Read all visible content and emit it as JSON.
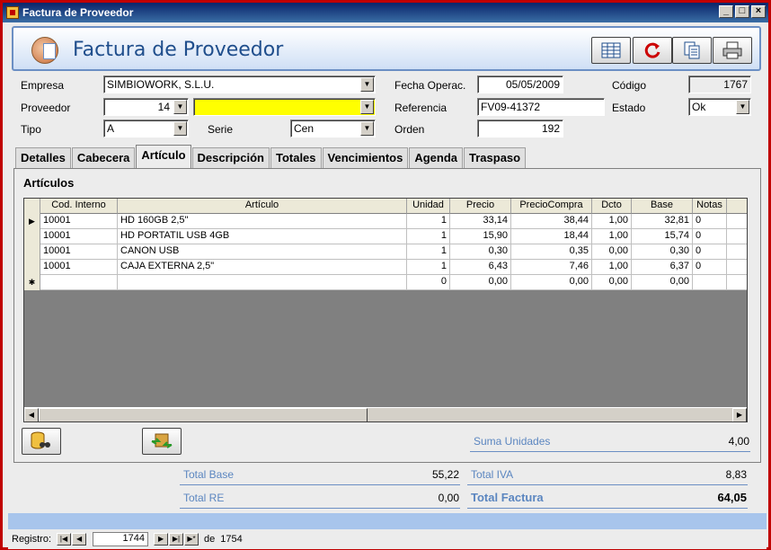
{
  "window": {
    "title": "Factura de Proveedor"
  },
  "header": {
    "title": "Factura de Proveedor"
  },
  "form": {
    "empresa_label": "Empresa",
    "empresa_value": "SIMBIOWORK, S.L.U.",
    "proveedor_label": "Proveedor",
    "proveedor_code": "14",
    "proveedor_name": "",
    "tipo_label": "Tipo",
    "tipo_value": "A",
    "serie_label": "Serie",
    "serie_value": "Cen",
    "fecha_label": "Fecha Operac.",
    "fecha_value": "05/05/2009",
    "referencia_label": "Referencia",
    "referencia_value": "FV09-41372",
    "orden_label": "Orden",
    "orden_value": "192",
    "codigo_label": "Código",
    "codigo_value": "1767",
    "estado_label": "Estado",
    "estado_value": "Ok"
  },
  "tabs": [
    "Detalles",
    "Cabecera",
    "Artículo",
    "Descripción",
    "Totales",
    "Vencimientos",
    "Agenda",
    "Traspaso"
  ],
  "active_tab": "Artículo",
  "panel": {
    "title": "Artículos"
  },
  "grid": {
    "columns": [
      "Cod. Interno",
      "Artículo",
      "Unidad",
      "Precio",
      "PrecioCompra",
      "Dcto",
      "Base",
      "Notas"
    ],
    "rows": [
      [
        "10001",
        "HD  160GB 2,5\"",
        "1",
        "33,14",
        "38,44",
        "1,00",
        "32,81",
        "0"
      ],
      [
        "10001",
        "HD PORTATIL USB 4GB",
        "1",
        "15,90",
        "18,44",
        "1,00",
        "15,74",
        "0"
      ],
      [
        "10001",
        "CANON USB",
        "1",
        "0,30",
        "0,35",
        "0,00",
        "0,30",
        "0"
      ],
      [
        "10001",
        "CAJA EXTERNA 2,5\"",
        "1",
        "6,43",
        "7,46",
        "1,00",
        "6,37",
        "0"
      ]
    ],
    "new_row": [
      "",
      "",
      "0",
      "0,00",
      "0,00",
      "0,00",
      "0,00",
      ""
    ]
  },
  "totals": {
    "suma_unidades_label": "Suma Unidades",
    "suma_unidades_value": "4,00",
    "total_base_label": "Total Base",
    "total_base_value": "55,22",
    "total_iva_label": "Total IVA",
    "total_iva_value": "8,83",
    "total_re_label": "Total RE",
    "total_re_value": "0,00",
    "total_factura_label": "Total Factura",
    "total_factura_value": "64,05"
  },
  "navigation": {
    "label": "Registro:",
    "current": "1744",
    "of_label": "de",
    "total": "1754"
  },
  "colors": {
    "title_bar": "#0a246a",
    "window_border": "#c00000",
    "accent": "#5b86c0",
    "highlight_field": "#ffff00"
  },
  "icons": [
    "grid-icon",
    "refresh-icon",
    "copy-icon",
    "print-icon",
    "database-search-icon",
    "transfer-icon"
  ]
}
